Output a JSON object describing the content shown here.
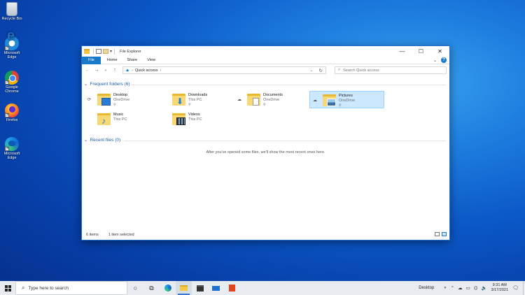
{
  "desktop": {
    "icons": [
      {
        "label": "Recycle Bin",
        "icon": "recycle-bin-icon"
      },
      {
        "label": "Microsoft Edge",
        "icon": "internet-explorer-icon"
      },
      {
        "label": "Google Chrome",
        "icon": "chrome-icon"
      },
      {
        "label": "Firefox",
        "icon": "firefox-icon"
      },
      {
        "label": "Microsoft Edge",
        "icon": "edge-icon"
      }
    ]
  },
  "window": {
    "title": "File Explorer",
    "ribbon": {
      "tabs": [
        "File",
        "Home",
        "Share",
        "View"
      ],
      "help": "?"
    },
    "address": {
      "location": "Quick access"
    },
    "search": {
      "placeholder": "Search Quick access"
    },
    "frequent": {
      "header": "Frequent folders (6)",
      "folders": [
        {
          "name": "Desktop",
          "location": "OneDrive",
          "cloud": "sync"
        },
        {
          "name": "Downloads",
          "location": "This PC",
          "cloud": ""
        },
        {
          "name": "Documents",
          "location": "OneDrive",
          "cloud": "cloud"
        },
        {
          "name": "Pictures",
          "location": "OneDrive",
          "cloud": "cloud",
          "selected": true
        },
        {
          "name": "Music",
          "location": "This PC",
          "cloud": ""
        },
        {
          "name": "Videos",
          "location": "This PC",
          "cloud": ""
        }
      ]
    },
    "recent": {
      "header": "Recent files (0)",
      "empty_message": "After you've opened some files, we'll show the most recent ones here."
    },
    "status": {
      "items": "6 items",
      "selection": "1 item selected"
    }
  },
  "taskbar": {
    "search_placeholder": "Type here to search",
    "desktop_label": "Desktop",
    "time": "9:31 AM",
    "date": "3/17/2021"
  },
  "colors": {
    "accent": "#1979ca",
    "selection": "#cce8ff",
    "desktop": "#0b58c8"
  }
}
